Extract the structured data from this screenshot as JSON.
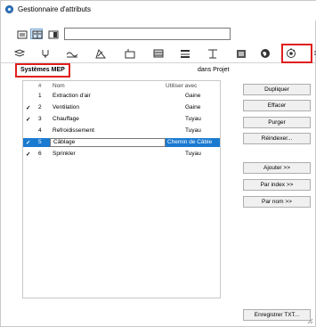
{
  "window": {
    "title": "Gestionnaire d'attributs"
  },
  "toolbar": {
    "view_modes": [
      "list-view-icon",
      "split-view-icon",
      "detail-view-icon"
    ],
    "active_view": 1,
    "search_value": ""
  },
  "attribute_tabs": [
    "layers-icon",
    "pen-icon",
    "line-type-icon",
    "fill-icon",
    "building-material-icon",
    "composite-icon",
    "profile-icon",
    "zone-icon",
    "surface-icon",
    "globe-icon",
    "mep-systems-icon",
    "more-icon"
  ],
  "active_tab": "mep-systems-icon",
  "section": {
    "title": "Systèmes MEP",
    "scope_label": "dans Projet"
  },
  "list": {
    "headers": {
      "num": "#",
      "name": "Nom",
      "use": "Utiliser avec"
    },
    "rows": [
      {
        "checked": false,
        "num": "1",
        "name": "Extraction d'air",
        "use": "Gaine",
        "selected": false
      },
      {
        "checked": true,
        "num": "2",
        "name": "Ventilation",
        "use": "Gaine",
        "selected": false
      },
      {
        "checked": true,
        "num": "3",
        "name": "Chauffage",
        "use": "Tuyau",
        "selected": false
      },
      {
        "checked": false,
        "num": "4",
        "name": "Refroidissement",
        "use": "Tuyau",
        "selected": false
      },
      {
        "checked": true,
        "num": "5",
        "name": "Câblage",
        "use": "Chemin de Câble",
        "selected": true
      },
      {
        "checked": true,
        "num": "6",
        "name": "Sprinkler",
        "use": "Tuyau",
        "selected": false
      }
    ],
    "check_glyph": "✓"
  },
  "buttons": {
    "dupliquer": "Dupliquer",
    "effacer": "Effacer",
    "purger": "Purger",
    "reindexer": "Réindexer...",
    "ajouter": "Ajouter >>",
    "par_index": "Par index >>",
    "par_nom": "Par nom >>",
    "enregistrer": "Enregistrer TXT..."
  },
  "colors": {
    "selection": "#1a7ad0",
    "highlight_box": "#e01e1e",
    "accent": "#2f78c8"
  }
}
